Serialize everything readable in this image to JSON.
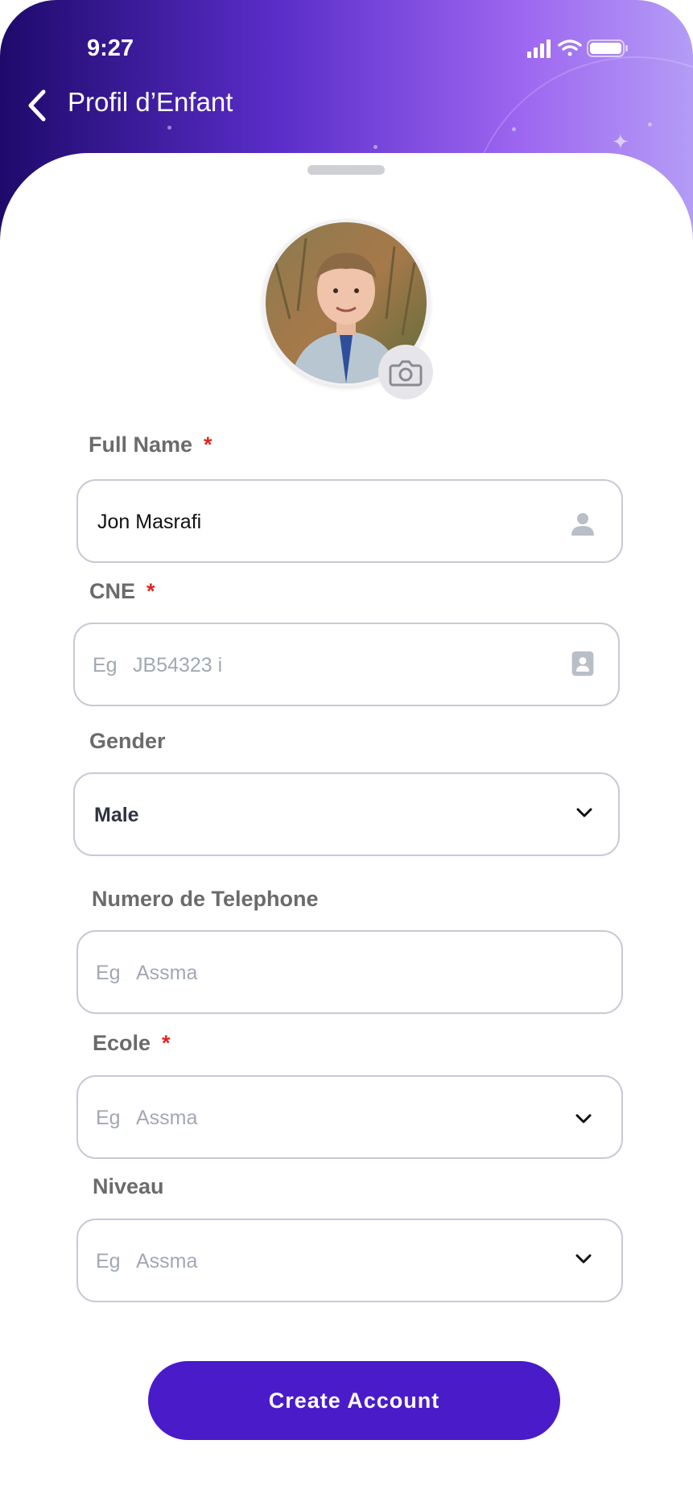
{
  "status_bar": {
    "time": "9:27"
  },
  "header": {
    "title": "Profil d’Enfant"
  },
  "form": {
    "full_name": {
      "label": "Full Name",
      "required_mark": "*",
      "value": "Jon Masrafi"
    },
    "cne": {
      "label": "CNE",
      "required_mark": "*",
      "placeholder_prefix": "Eg",
      "placeholder": "JB54323 i"
    },
    "gender": {
      "label": "Gender",
      "value": "Male"
    },
    "phone": {
      "label": "Numero de Telephone",
      "placeholder_prefix": "Eg",
      "placeholder": "Assma"
    },
    "ecole": {
      "label": "Ecole",
      "required_mark": "*",
      "placeholder_prefix": "Eg",
      "placeholder": "Assma"
    },
    "niveau": {
      "label": "Niveau",
      "placeholder_prefix": "Eg",
      "placeholder": "Assma"
    }
  },
  "actions": {
    "create_account": "Create Account"
  },
  "colors": {
    "accent": "#4a1bc9",
    "required": "#e02424",
    "header_start": "#1e0a6b",
    "header_end": "#b49cf6"
  },
  "icons": [
    "back-arrow-icon",
    "signal-icon",
    "wifi-icon",
    "battery-icon",
    "camera-icon",
    "user-icon",
    "id-card-icon",
    "chevron-down-icon"
  ]
}
